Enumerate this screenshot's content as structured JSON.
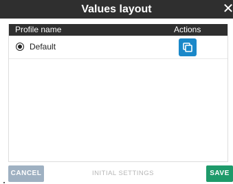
{
  "dialog": {
    "title": "Values layout",
    "close_symbol": "✕"
  },
  "table": {
    "columns": [
      "Profile name",
      "Actions"
    ],
    "rows": [
      {
        "name": "Default",
        "selected": true,
        "action_icon": "copy-icon"
      }
    ]
  },
  "footer": {
    "cancel_label": "CANCEL",
    "initial_settings_label": "INITIAL SETTINGS",
    "save_label": "SAVE"
  },
  "colors": {
    "header_bg": "#2f2f2f",
    "accent_blue": "#1a88c9",
    "cancel_bg": "#9fb1c2",
    "save_bg": "#1e9a6a"
  }
}
